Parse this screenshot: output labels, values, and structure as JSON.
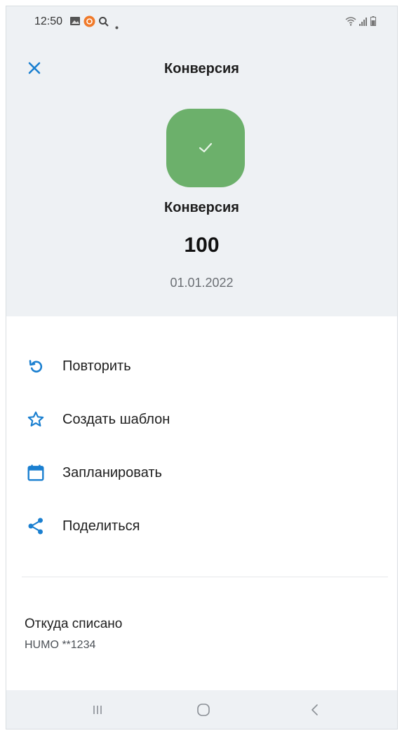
{
  "status_bar": {
    "time": "12:50",
    "icons": [
      "gallery-icon",
      "app-notification-icon",
      "search-icon",
      "dot-icon"
    ],
    "right_icons": [
      "wifi-icon",
      "signal-icon",
      "battery-icon"
    ]
  },
  "header": {
    "title": "Конверсия",
    "close_icon": "close-icon"
  },
  "transaction": {
    "status_icon": "checkmark-icon",
    "status_color": "#6cb06b",
    "name": "Конверсия",
    "amount": "100",
    "date": "01.01.2022"
  },
  "actions": [
    {
      "label": "Повторить",
      "icon": "repeat-icon"
    },
    {
      "label": "Создать шаблон",
      "icon": "star-icon"
    },
    {
      "label": "Запланировать",
      "icon": "calendar-icon"
    },
    {
      "label": "Поделиться",
      "icon": "share-icon"
    }
  ],
  "source": {
    "title": "Откуда списано",
    "value": "HUMO **1234"
  },
  "nav_bar": {
    "buttons": [
      "recent-apps-icon",
      "home-icon",
      "back-icon"
    ]
  },
  "colors": {
    "accent": "#1a7fd0",
    "header_bg": "#eef1f4",
    "success": "#6cb06b"
  }
}
